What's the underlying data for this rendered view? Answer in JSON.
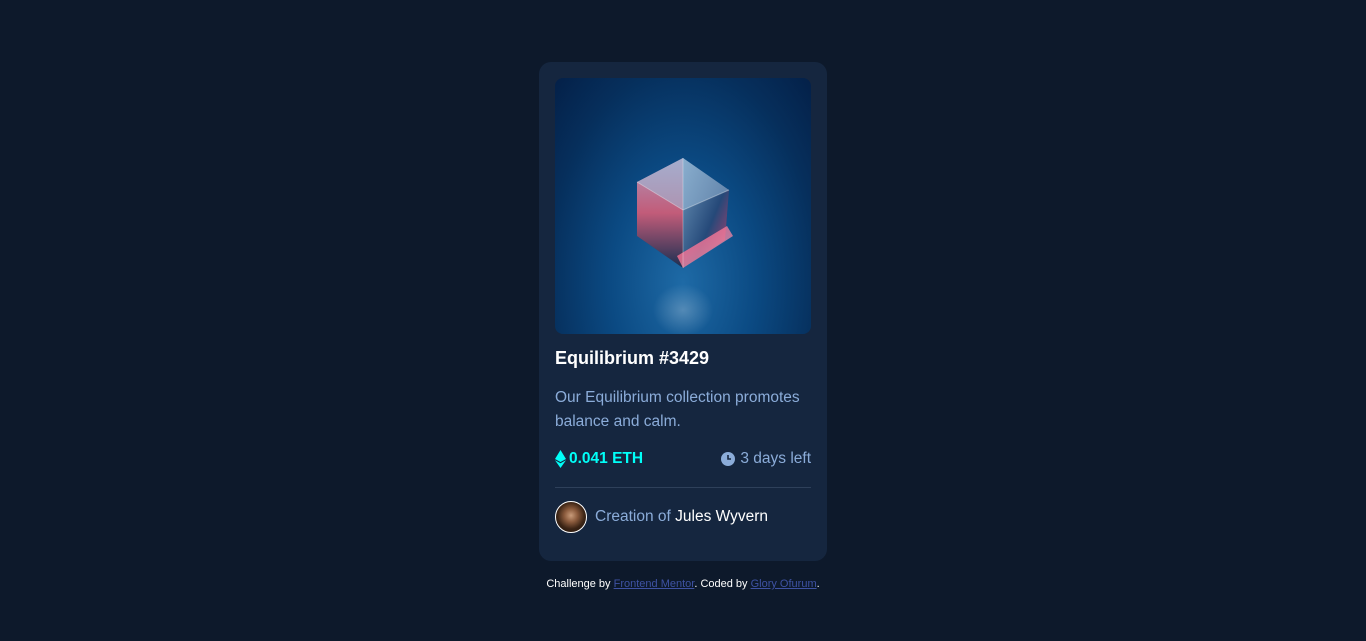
{
  "card": {
    "title": "Equilibrium #3429",
    "description": "Our Equilibrium collection promotes balance and calm.",
    "price": "0.041 ETH",
    "time_left": "3 days left",
    "creator_prefix": "Creation of",
    "creator_name": "Jules Wyvern",
    "image_icon": "cube-image",
    "price_icon": "ethereum-icon",
    "time_icon": "clock-icon"
  },
  "attribution": {
    "prefix": "Challenge by",
    "link1": "Frontend Mentor",
    "middle": ". Coded by",
    "link2": "Glory Ofurum",
    "suffix": "."
  },
  "colors": {
    "background": "#0d192b",
    "card": "#15263f",
    "accent_cyan": "#00fff8",
    "soft_blue": "#8bacd9",
    "link": "#3e52a3"
  }
}
